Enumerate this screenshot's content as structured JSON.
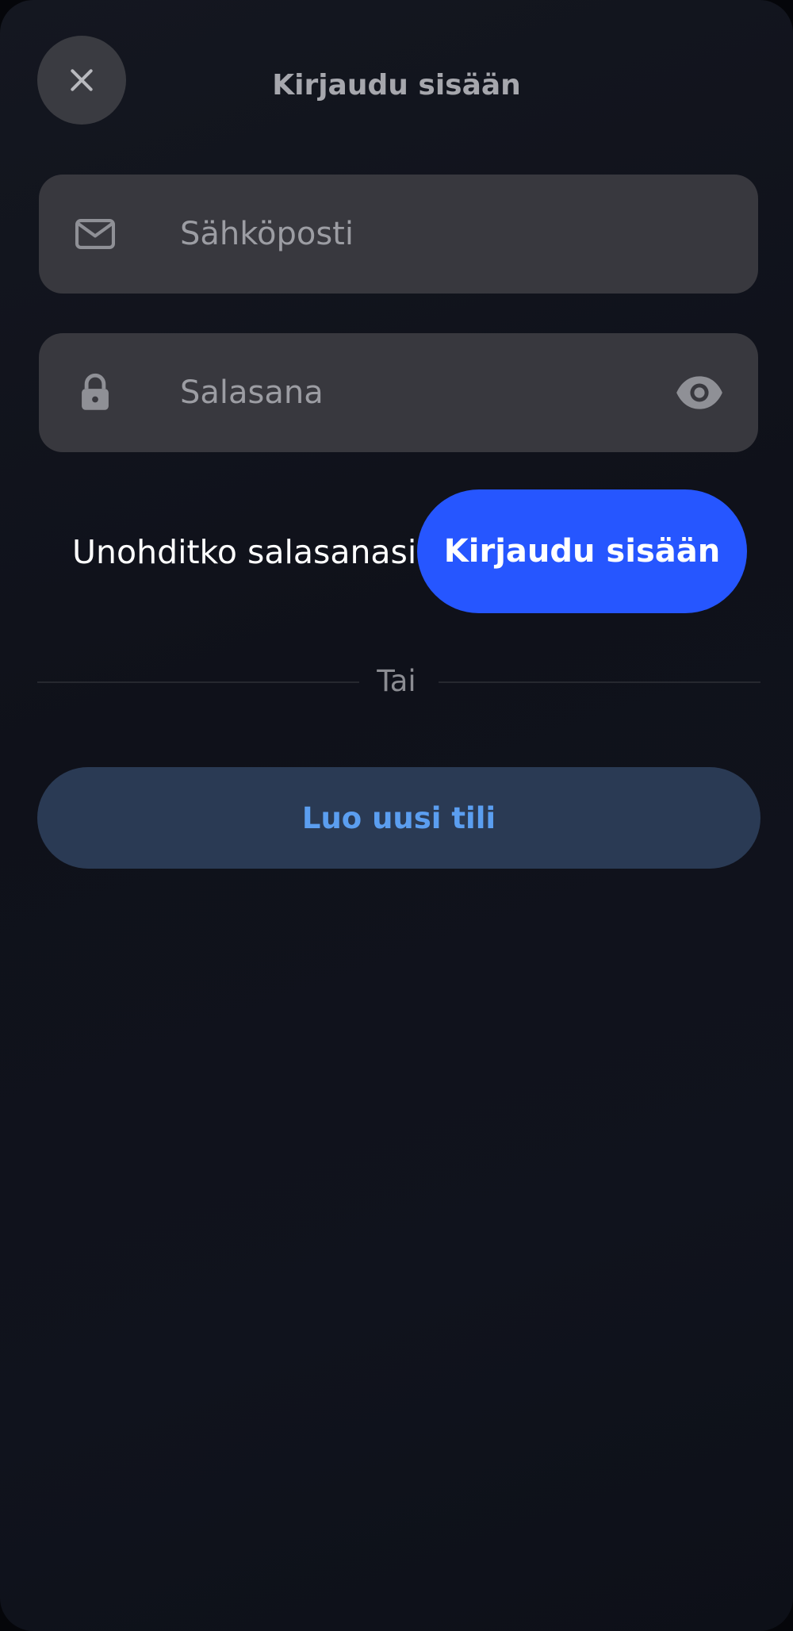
{
  "header": {
    "title": "Kirjaudu sisään",
    "close_icon": "close-icon"
  },
  "form": {
    "email": {
      "icon": "mail-icon",
      "placeholder": "Sähköposti",
      "value": ""
    },
    "password": {
      "icon": "lock-icon",
      "placeholder": "Salasana",
      "value": "",
      "toggle_icon": "eye-icon"
    },
    "forgot_label": "Unohditko salasanasi?",
    "login_label": "Kirjaudu sisään"
  },
  "divider": {
    "label": "Tai"
  },
  "register": {
    "label": "Luo uusi tili"
  },
  "colors": {
    "primary": "#2656ff",
    "secondary_bg": "#2a3a54",
    "secondary_text": "#5b9ef0",
    "field_bg": "#38383e"
  }
}
